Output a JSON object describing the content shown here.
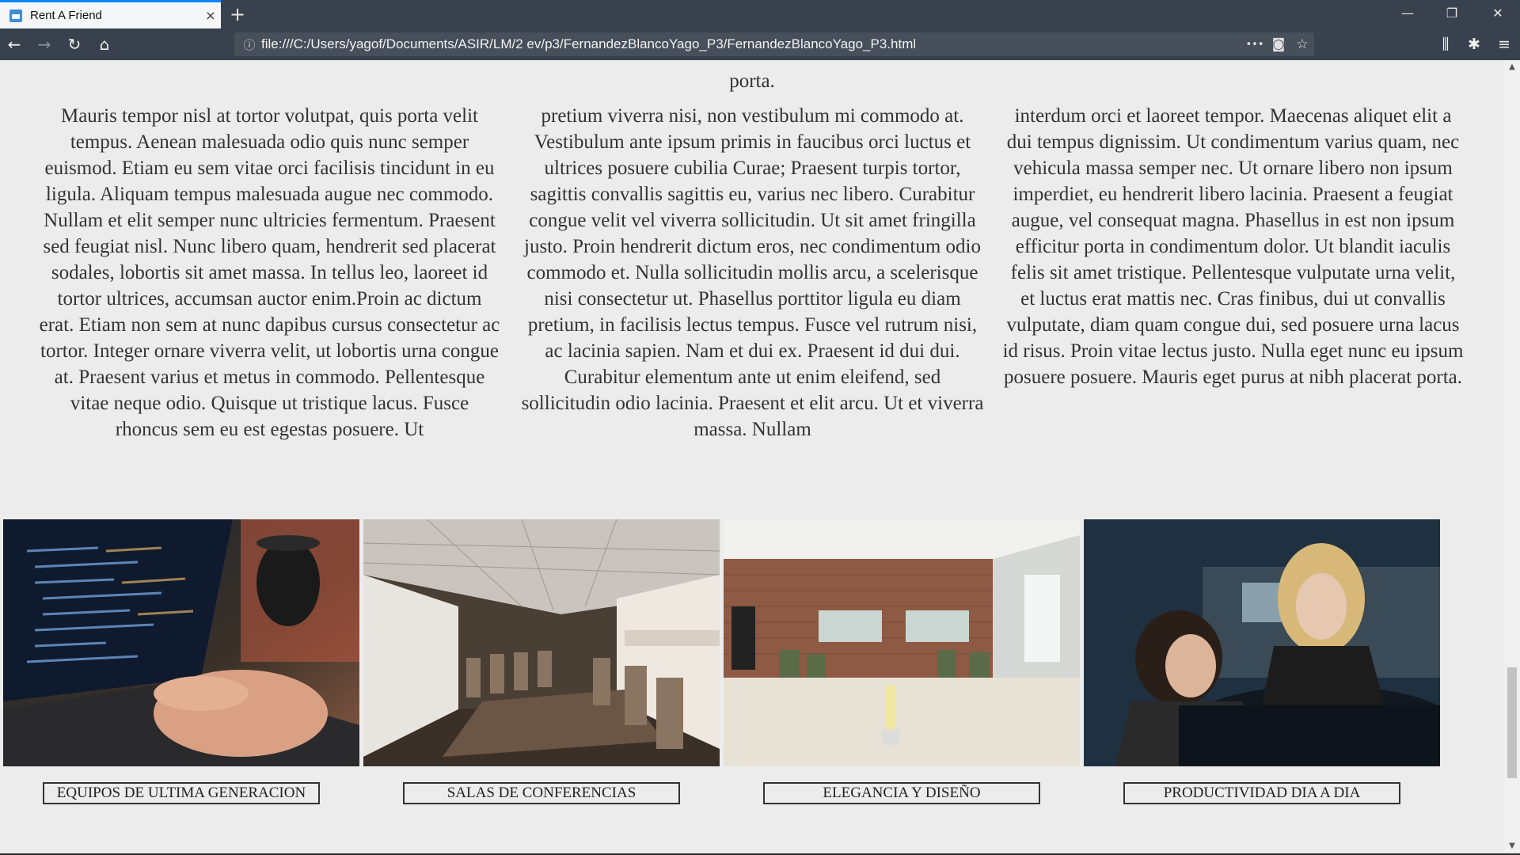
{
  "browser": {
    "tab_title": "Rent A Friend",
    "url": "file:///C:/Users/yagof/Documents/ASIR/LM/2 ev/p3/FernandezBlancoYago_P3/FernandezBlancoYago_P3.html",
    "icons": {
      "close": "×",
      "newtab": "+",
      "minimize": "—",
      "restore": "❐",
      "window_close": "✕",
      "back": "←",
      "forward": "→",
      "reload": "↻",
      "home": "⌂",
      "info": "ⓘ",
      "more": "•••",
      "pocket": "◙",
      "star": "☆",
      "library": "⫼",
      "extensions": "✱",
      "menu": "≡"
    }
  },
  "page": {
    "cut_text": "porta.",
    "columns": [
      "Mauris tempor nisl at tortor volutpat, quis porta velit tempus. Aenean malesuada odio quis nunc semper euismod. Etiam eu sem vitae orci facilisis tincidunt in eu ligula. Aliquam tempus malesuada augue nec commodo. Nullam et elit semper nunc ultricies fermentum. Praesent sed feugiat nisl. Nunc libero quam, hendrerit sed placerat sodales, lobortis sit amet massa. In tellus leo, laoreet id tortor ultrices, accumsan auctor enim.Proin ac dictum erat. Etiam non sem at nunc dapibus cursus consectetur ac tortor. Integer ornare viverra velit, ut lobortis urna congue at. Praesent varius et metus in commodo. Pellentesque vitae neque odio. Quisque ut tristique lacus. Fusce rhoncus sem eu est egestas posuere. Ut",
      "pretium viverra nisi, non vestibulum mi commodo at. Vestibulum ante ipsum primis in faucibus orci luctus et ultrices posuere cubilia Curae; Praesent turpis tortor, sagittis convallis sagittis eu, varius nec libero. Curabitur congue velit vel viverra sollicitudin. Ut sit amet fringilla justo. Proin hendrerit dictum eros, nec condimentum odio commodo et. Nulla sollicitudin mollis arcu, a scelerisque nisi consectetur ut. Phasellus porttitor ligula eu diam pretium, in facilisis lectus tempus. Fusce vel rutrum nisi, ac lacinia sapien. Nam et dui ex. Praesent id dui dui. Curabitur elementum ante ut enim eleifend, sed sollicitudin odio lacinia. Praesent et elit arcu. Ut et viverra massa. Nullam",
      "interdum orci et laoreet tempor. Maecenas aliquet elit a dui tempus dignissim. Ut condimentum varius quam, nec vehicula massa semper nec. Ut ornare libero non ipsum imperdiet, eu hendrerit libero lacinia. Praesent a feugiat augue, vel consequat magna. Phasellus in est non ipsum efficitur porta in condimentum dolor. Ut blandit iaculis felis sit amet tristique. Pellentesque vulputate urna velit, et luctus erat mattis nec. Cras finibus, dui ut convallis vulputate, diam quam congue dui, sed posuere urna lacus id risus. Proin vitae lectus justo. Nulla eget nunc eu ipsum posuere posuere. Mauris eget purus at nibh placerat porta."
    ],
    "gallery": [
      {
        "caption": "EQUIPOS DE ULTIMA GENERACION"
      },
      {
        "caption": "SALAS DE CONFERENCIAS"
      },
      {
        "caption": "ELEGANCIA Y DISEÑO"
      },
      {
        "caption": "PRODUCTIVIDAD DIA A DIA"
      }
    ]
  }
}
